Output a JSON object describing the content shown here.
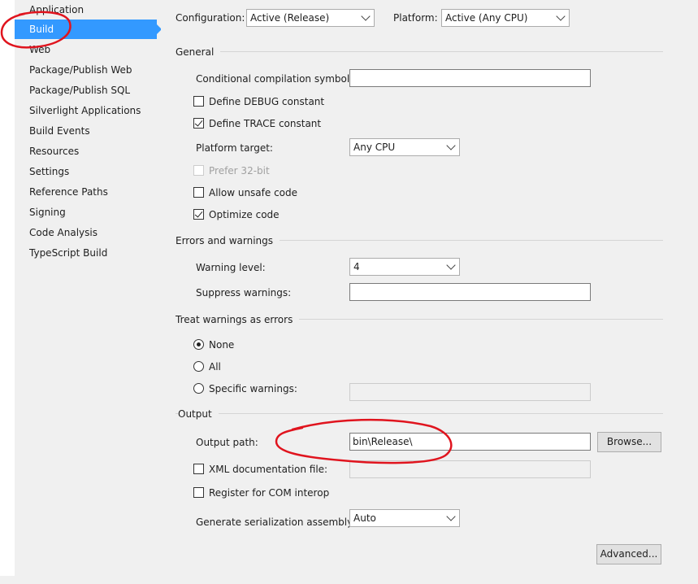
{
  "sidebar": {
    "items": [
      {
        "label": "Application"
      },
      {
        "label": "Build"
      },
      {
        "label": "Web"
      },
      {
        "label": "Package/Publish Web"
      },
      {
        "label": "Package/Publish SQL"
      },
      {
        "label": "Silverlight Applications"
      },
      {
        "label": "Build Events"
      },
      {
        "label": "Resources"
      },
      {
        "label": "Settings"
      },
      {
        "label": "Reference Paths"
      },
      {
        "label": "Signing"
      },
      {
        "label": "Code Analysis"
      },
      {
        "label": "TypeScript Build"
      }
    ],
    "selected": "Build"
  },
  "toolbar": {
    "configuration_label": "Configuration:",
    "configuration_value": "Active (Release)",
    "platform_label": "Platform:",
    "platform_value": "Active (Any CPU)"
  },
  "general": {
    "title": "General",
    "conditional_label": "Conditional compilation symbols:",
    "conditional_value": "",
    "define_debug_label": "Define DEBUG constant",
    "define_debug_checked": false,
    "define_trace_label": "Define TRACE constant",
    "define_trace_checked": true,
    "platform_target_label": "Platform target:",
    "platform_target_value": "Any CPU",
    "prefer32_label": "Prefer 32-bit",
    "prefer32_enabled": false,
    "allow_unsafe_label": "Allow unsafe code",
    "allow_unsafe_checked": false,
    "optimize_label": "Optimize code",
    "optimize_checked": true
  },
  "errors": {
    "title": "Errors and warnings",
    "warning_level_label": "Warning level:",
    "warning_level_value": "4",
    "suppress_label": "Suppress warnings:",
    "suppress_value": ""
  },
  "treat_warnings": {
    "title": "Treat warnings as errors",
    "none_label": "None",
    "all_label": "All",
    "specific_label": "Specific warnings:",
    "selected": "None",
    "specific_value": ""
  },
  "output": {
    "title": "Output",
    "path_label": "Output path:",
    "path_value": "bin\\Release\\",
    "browse_label": "Browse...",
    "xml_doc_label": "XML documentation file:",
    "xml_doc_checked": false,
    "xml_doc_value": "",
    "com_interop_label": "Register for COM interop",
    "com_interop_checked": false,
    "serialization_label": "Generate serialization assembly:",
    "serialization_value": "Auto",
    "advanced_label": "Advanced..."
  },
  "colors": {
    "selection": "#3399ff",
    "annotation": "#e0141e",
    "panel_background": "#f0f0f0"
  }
}
